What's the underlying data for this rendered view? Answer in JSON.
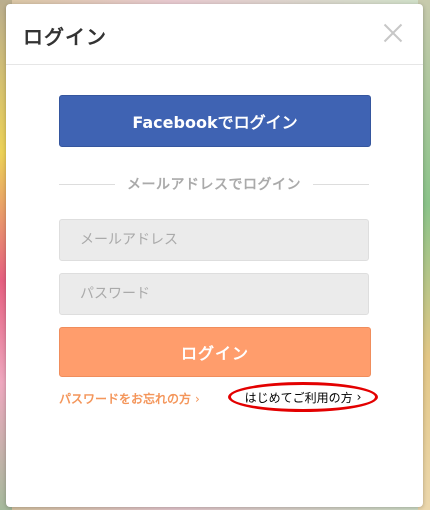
{
  "dialog": {
    "title": "ログイン",
    "close_icon": "close-icon"
  },
  "facebook": {
    "label": "Facebookでログイン",
    "color": "#3f63b3"
  },
  "divider": {
    "label": "メールアドレスでログイン"
  },
  "form": {
    "email_placeholder": "メールアドレス",
    "password_placeholder": "パスワード",
    "email_value": "",
    "password_value": ""
  },
  "login_button": {
    "label": "ログイン",
    "color": "#ff9d6c"
  },
  "links": {
    "forgot_password": "パスワードをお忘れの方",
    "forgot_chevron": "›",
    "first_time": "はじめてご利用の方",
    "first_time_chevron": "›"
  }
}
